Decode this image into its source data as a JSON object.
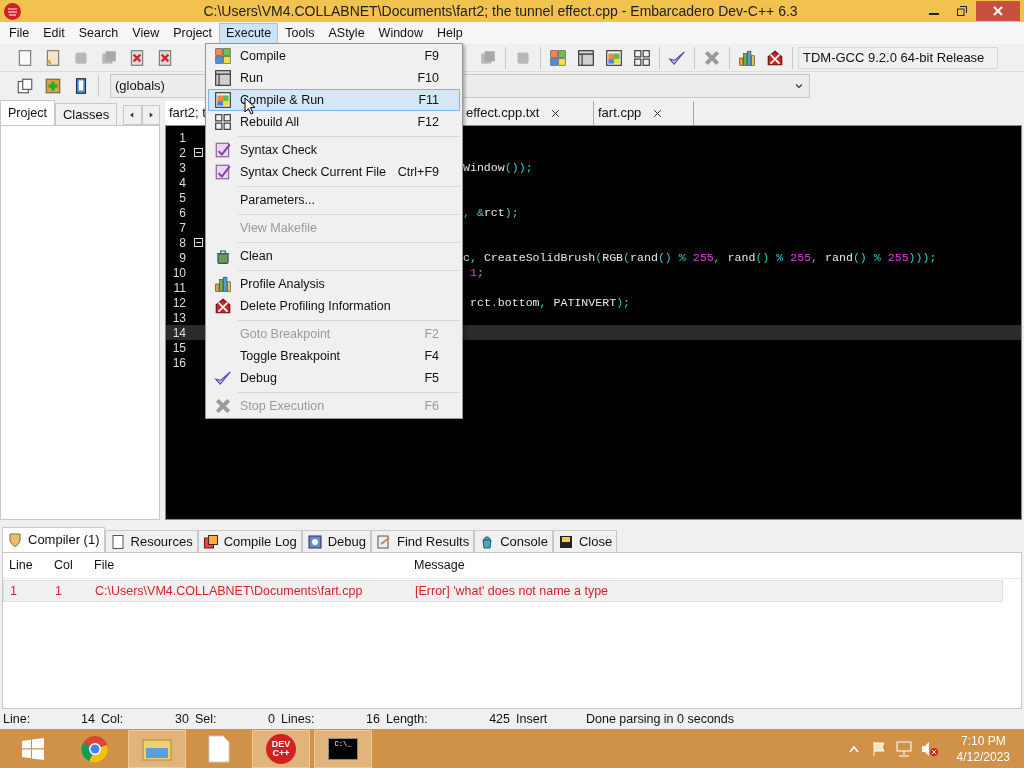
{
  "window": {
    "title": "C:\\Users\\VM4.COLLABNET\\Documents\\fart2; the tunnel effect.cpp - Embarcadero Dev-C++ 6.3"
  },
  "menu_bar": [
    {
      "label": "File",
      "selected": false
    },
    {
      "label": "Edit",
      "selected": false
    },
    {
      "label": "Search",
      "selected": false
    },
    {
      "label": "View",
      "selected": false
    },
    {
      "label": "Project",
      "selected": false
    },
    {
      "label": "Execute",
      "selected": true
    },
    {
      "label": "Tools",
      "selected": false
    },
    {
      "label": "AStyle",
      "selected": false
    },
    {
      "label": "Window",
      "selected": false
    },
    {
      "label": "Help",
      "selected": false
    }
  ],
  "toolbar": {
    "compiler": "TDM-GCC 9.2.0 64-bit Release",
    "scope": "(globals)"
  },
  "left_panel": {
    "tabs": [
      {
        "label": "Project",
        "selected": true
      },
      {
        "label": "Classes",
        "selected": false
      }
    ]
  },
  "editor": {
    "tabs": [
      {
        "label": "fart2; t",
        "selected": true,
        "closable": false
      },
      {
        "label": "effect.cpp.txt",
        "selected": false,
        "closable": true
      },
      {
        "label": "fart.cpp",
        "selected": false,
        "closable": true
      }
    ],
    "lines": [
      {
        "number": "1",
        "fold": false,
        "current": false
      },
      {
        "number": "2",
        "fold": true,
        "current": false
      },
      {
        "number": "3",
        "fold": false,
        "current": false,
        "code": "Window());"
      },
      {
        "number": "4",
        "fold": false,
        "current": false
      },
      {
        "number": "5",
        "fold": false,
        "current": false
      },
      {
        "number": "6",
        "fold": false,
        "current": false,
        "code": ", &rct);"
      },
      {
        "number": "7",
        "fold": false,
        "current": false
      },
      {
        "number": "8",
        "fold": true,
        "current": false
      },
      {
        "number": "9",
        "fold": false,
        "current": false,
        "code": "c, CreateSolidBrush(RGB(rand() % 255, rand() % 255, rand() % 255)));"
      },
      {
        "number": "10",
        "fold": false,
        "current": false,
        "code": " 1;"
      },
      {
        "number": "11",
        "fold": false,
        "current": false
      },
      {
        "number": "12",
        "fold": false,
        "current": false,
        "code": " rct.bottom, PATINVERT);"
      },
      {
        "number": "13",
        "fold": false,
        "current": false
      },
      {
        "number": "14",
        "fold": false,
        "current": true
      },
      {
        "number": "15",
        "fold": false,
        "current": false
      },
      {
        "number": "16",
        "fold": false,
        "current": false
      }
    ]
  },
  "execute_menu": [
    [
      {
        "label": "Compile",
        "shortcut": "F9",
        "disabled": false,
        "selected": false
      },
      {
        "label": "Run",
        "shortcut": "F10",
        "disabled": false,
        "selected": false
      },
      {
        "label": "Compile & Run",
        "shortcut": "F11",
        "disabled": false,
        "selected": true
      },
      {
        "label": "Rebuild All",
        "shortcut": "F12",
        "disabled": false,
        "selected": false
      }
    ],
    [
      {
        "label": "Syntax Check",
        "disabled": false,
        "selected": false
      },
      {
        "label": "Syntax Check Current File",
        "shortcut": "Ctrl+F9",
        "disabled": false,
        "selected": false
      }
    ],
    [
      {
        "label": "Parameters...",
        "disabled": false,
        "selected": false
      }
    ],
    [
      {
        "label": "View Makefile",
        "disabled": true,
        "selected": false
      }
    ],
    [
      {
        "label": "Clean",
        "disabled": false,
        "selected": false
      }
    ],
    [
      {
        "label": "Profile Analysis",
        "disabled": false,
        "selected": false
      },
      {
        "label": "Delete Profiling Information",
        "disabled": false,
        "selected": false
      }
    ],
    [
      {
        "label": "Goto Breakpoint",
        "shortcut": "F2",
        "disabled": true,
        "selected": false
      },
      {
        "label": "Toggle Breakpoint",
        "shortcut": "F4",
        "disabled": false,
        "selected": false
      },
      {
        "label": "Debug",
        "shortcut": "F5",
        "disabled": false,
        "selected": false
      }
    ],
    [
      {
        "label": "Stop Execution",
        "shortcut": "F6",
        "disabled": true,
        "selected": false
      }
    ]
  ],
  "bottom_panel": {
    "tabs": [
      {
        "label": "Compiler (1)",
        "selected": true
      },
      {
        "label": "Resources",
        "selected": false
      },
      {
        "label": "Compile Log",
        "selected": false
      },
      {
        "label": "Debug",
        "selected": false
      },
      {
        "label": "Find Results",
        "selected": false
      },
      {
        "label": "Console",
        "selected": false
      },
      {
        "label": "Close",
        "selected": false
      }
    ],
    "columns": [
      "Line",
      "Col",
      "File",
      "Message"
    ],
    "rows": [
      {
        "cells": [
          "1",
          "1",
          "C:\\Users\\VM4.COLLABNET\\Documents\\fart.cpp",
          "[Error] 'what' does not name a type"
        ],
        "selected": true
      }
    ]
  },
  "status_bar": [
    {
      "label": "Line:",
      "value": "14"
    },
    {
      "label": "Col:",
      "value": "30"
    },
    {
      "label": "Sel:",
      "value": "0"
    },
    {
      "label": "Lines:",
      "value": "16"
    },
    {
      "label": "Length:",
      "value": "425"
    }
  ],
  "status_mode": "Insert",
  "status_message": "Done parsing in 0 seconds",
  "taskbar": {
    "apps": [
      {
        "running": false
      },
      {
        "running": false
      },
      {
        "running": true
      },
      {
        "running": false
      },
      {
        "running": true,
        "icon_text": "DEV C++"
      },
      {
        "running": true,
        "icon_text": "C:\\_"
      }
    ],
    "time": "7:10 PM",
    "date": "4/12/2023"
  }
}
